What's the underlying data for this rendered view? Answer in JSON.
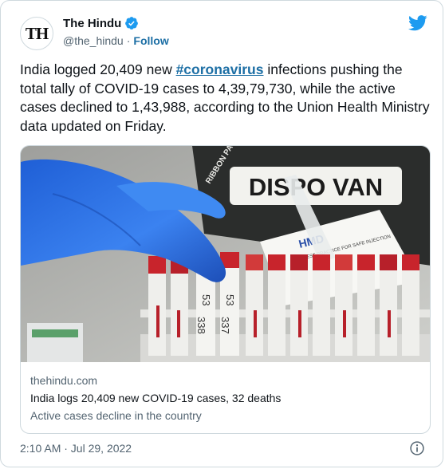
{
  "account": {
    "avatar_text": "TH",
    "name": "The Hindu",
    "handle": "@the_hindu",
    "separator": "·",
    "follow_label": "Follow",
    "verified_icon": "verified-badge-icon",
    "brand_icon": "twitter-bird-icon"
  },
  "tweet": {
    "text_before": "India logged 20,409 new ",
    "hashtag": "#coronavirus",
    "text_after": " infections pushing the total tally of COVID-19 cases to 4,39,79,730, while the active cases declined to 1,43,988, according to the Union Health Ministry data updated on Friday."
  },
  "card": {
    "domain": "thehindu.com",
    "title": "India logs 20,409 new COVID-19 cases, 32 deaths",
    "description": "Active cases decline in the country",
    "image": {
      "brand_label": "DISPO VAN",
      "ribbon_label": "RIBBON PA",
      "sheet_label": "HMD",
      "sheet_caption": "BEST PRACTICE FOR SAFE INJECTION",
      "tube_label_1": "53",
      "tube_label_2": "338",
      "tube_label_3": "53",
      "tube_label_4": "337"
    }
  },
  "footer": {
    "timestamp": "2:10 AM · Jul 29, 2022",
    "info_icon": "info-icon"
  },
  "colors": {
    "accent": "#1d6fa5",
    "twitter_blue": "#1d9bf0",
    "glove_blue": "#2d6fe0",
    "cap_red": "#c8242c"
  }
}
